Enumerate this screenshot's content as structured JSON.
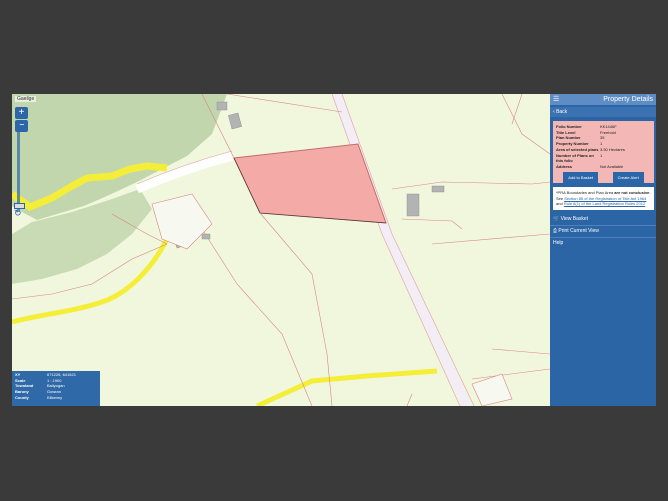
{
  "map": {
    "language_link": "Gaeilge",
    "zoom_in": "+",
    "zoom_out": "−",
    "reset_icon": "refresh-icon"
  },
  "info": {
    "rows": [
      {
        "label": "XY",
        "value": "671226, 641621"
      },
      {
        "label": "Scale",
        "value": "1 : 1900"
      },
      {
        "label": "Townland",
        "value": "Ballyogan"
      },
      {
        "label": "Barony",
        "value": "Gowran"
      },
      {
        "label": "County",
        "value": "Kilkenny"
      }
    ]
  },
  "panel": {
    "title": "Property Details",
    "back_label": "Back",
    "property": {
      "rows": [
        {
          "label": "Folio Number",
          "value": "KK1446F"
        },
        {
          "label": "Title Level",
          "value": "Freehold"
        },
        {
          "label": "Plan Number",
          "value": "35"
        },
        {
          "label": "Property Number",
          "value": "1"
        },
        {
          "label": "Area of selected plans",
          "value": "3.50 Hectares"
        },
        {
          "label": "Number of Plans on this folio",
          "value": "1"
        },
        {
          "label": "Address",
          "value": "Not Available"
        }
      ],
      "add_to_basket": "Add to Basket",
      "create_alert": "Create Alert"
    },
    "notice": {
      "part1": "*PRA Boundaries and Plan Area",
      "bold": "are not conclusive",
      "part2": ". See",
      "link1": "Section 85 of the Registration of Title Act 1964",
      "part3": "and",
      "link2": "Rule 8(1) of the Land Registration Rules 2012"
    },
    "nav": [
      {
        "label": "View Basket",
        "icon": "basket-icon"
      },
      {
        "label": "Print Current View",
        "icon": "print-icon"
      },
      {
        "label": "Help",
        "icon": ""
      }
    ]
  },
  "colors": {
    "panel_blue": "#2c65a6",
    "selected_parcel": "#f4aaa6",
    "road_yellow": "#f5ee38",
    "forest_green": "#bcd3a8"
  }
}
